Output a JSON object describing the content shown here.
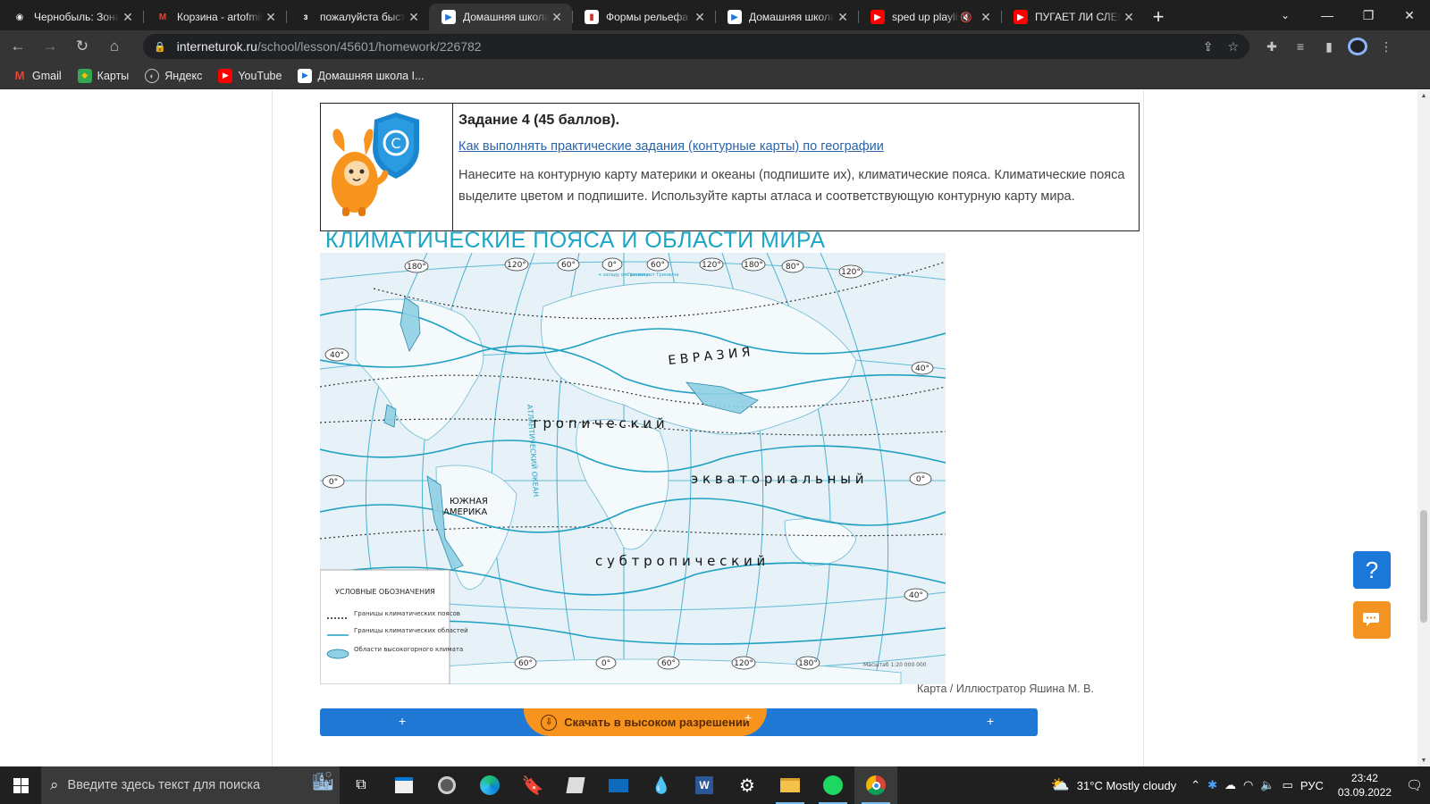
{
  "browser": {
    "tabs": [
      {
        "title": "Чернобыль: Зона отчуждения",
        "favicon": "incognito-icon",
        "color": "#e8eaed",
        "active": false
      },
      {
        "title": "Корзина - artofmil",
        "favicon": "gmail-icon",
        "color": "#ea4335",
        "active": false
      },
      {
        "title": "пожалуйста быстрее",
        "favicon": "znanija-icon",
        "color": "#111111",
        "active": false
      },
      {
        "title": "Домашняя школа",
        "favicon": "interneturok-icon",
        "color": "#ffffff",
        "active": true
      },
      {
        "title": "Формы рельефа",
        "favicon": "presentation-icon",
        "color": "#d93025",
        "active": false
      },
      {
        "title": "Домашняя школа",
        "favicon": "interneturok-icon",
        "color": "#ffffff",
        "active": false
      },
      {
        "title": "sped up playlist",
        "favicon": "youtube-icon",
        "color": "#ff0000",
        "active": false,
        "muted": true
      },
      {
        "title": "ПУГАЕТ ЛИ СЛЕНДЕР",
        "favicon": "youtube-icon",
        "color": "#ff0000",
        "active": false
      }
    ],
    "url_host": "interneturok.ru",
    "url_path": "/school/lesson/45601/homework/226782",
    "bookmarks": [
      {
        "label": "Gmail",
        "icon": "gmail-icon"
      },
      {
        "label": "Карты",
        "icon": "maps-icon"
      },
      {
        "label": "Яндекс",
        "icon": "yandex-icon"
      },
      {
        "label": "YouTube",
        "icon": "youtube-icon"
      },
      {
        "label": "Домашняя школа I...",
        "icon": "interneturok-icon"
      }
    ]
  },
  "task": {
    "title": "Задание 4 (45 баллов).",
    "link": "Как выполнять практические задания (контурные карты) по географии",
    "text": "Нанесите на контурную карту материки и океаны (подпишите их), климатические пояса. Климатические пояса выделите цветом и подпишите. Используйте карты атласа и соответствующую контурную карту мира."
  },
  "map": {
    "title": "КЛИМАТИЧЕСКИЕ ПОЯСА И ОБЛАСТИ МИРА",
    "label_eurasia": "Е В Р А З И Я",
    "label_tropical": "т р о п и ч е с к и й",
    "label_equatorial": "э к в а т о р и а л ь н ы й",
    "label_subtropical": "с у б т р о п и ч е с к и й",
    "label_south_america_1": "ЮЖНАЯ",
    "label_south_america_2": "АМЕРИКА",
    "label_atlantic": "АТЛАНТИЧЕСКИЙ ОКЕАН",
    "top_degrees": [
      "180°",
      "120°",
      "60°",
      "0°",
      "60°",
      "120°",
      "180°",
      "80°",
      "120°"
    ],
    "bottom_degrees": [
      "60°",
      "0°",
      "60°",
      "120°",
      "180°"
    ],
    "lat_left_top": "40°",
    "lat_left_mid": "0°",
    "lat_right_top": "40°",
    "lat_right_mid": "0°",
    "lat_right_bot": "40°",
    "west_note": "к западу от Гринвича",
    "east_note": "к востоку от Гринвича",
    "legend_title": "УСЛОВНЫЕ ОБОЗНАЧЕНИЯ",
    "legend_items": [
      "Границы климатических поясов",
      "Границы климатических областей",
      "Области высокогорного климата"
    ],
    "scale": "Масштаб 1:20 000 000"
  },
  "credit": "Карта / Иллюстратор Яшина М. В.",
  "download": "Скачать в высоком разрешении",
  "taskbar": {
    "search_placeholder": "Введите здесь текст для поиска",
    "weather": "31°C  Mostly cloudy",
    "lang": "РУС",
    "time": "23:42",
    "date": "03.09.2022"
  },
  "colors": {
    "map_line": "#27a5c7",
    "map_title": "#1aa6c5",
    "accent_blue": "#1f78d3",
    "accent_orange": "#f7941e"
  }
}
